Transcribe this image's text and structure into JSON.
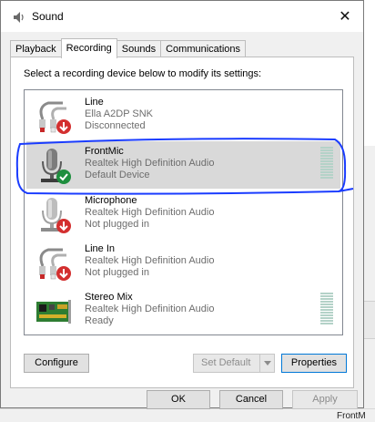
{
  "window": {
    "title": "Sound",
    "close_glyph": "✕"
  },
  "tabs": [
    {
      "label": "Playback"
    },
    {
      "label": "Recording"
    },
    {
      "label": "Sounds"
    },
    {
      "label": "Communications"
    }
  ],
  "panel": {
    "caption": "Select a recording device below to modify its settings:"
  },
  "devices": [
    {
      "name": "Line",
      "driver": "Ella A2DP SNK",
      "status": "Disconnected",
      "icon": "line-in-cable-icon",
      "badge": "red-down-arrow-icon"
    },
    {
      "name": "FrontMic",
      "driver": "Realtek High Definition Audio",
      "status": "Default Device",
      "icon": "microphone-icon",
      "badge": "green-check-icon"
    },
    {
      "name": "Microphone",
      "driver": "Realtek High Definition Audio",
      "status": "Not plugged in",
      "icon": "microphone-icon",
      "badge": "red-down-arrow-icon"
    },
    {
      "name": "Line In",
      "driver": "Realtek High Definition Audio",
      "status": "Not plugged in",
      "icon": "line-in-cable-icon",
      "badge": "red-down-arrow-icon"
    },
    {
      "name": "Stereo Mix",
      "driver": "Realtek High Definition Audio",
      "status": "Ready",
      "icon": "sound-card-icon",
      "badge": ""
    }
  ],
  "buttons": {
    "configure": "Configure",
    "set_default": "Set Default",
    "properties": "Properties",
    "ok": "OK",
    "cancel": "Cancel",
    "apply": "Apply"
  },
  "background": {
    "fragment": "FrontM"
  },
  "colors": {
    "selection": "#d9d9d9",
    "focus_border": "#0078d7",
    "annotation": "#1a3cff",
    "level_meter": "#b4d2c8"
  }
}
